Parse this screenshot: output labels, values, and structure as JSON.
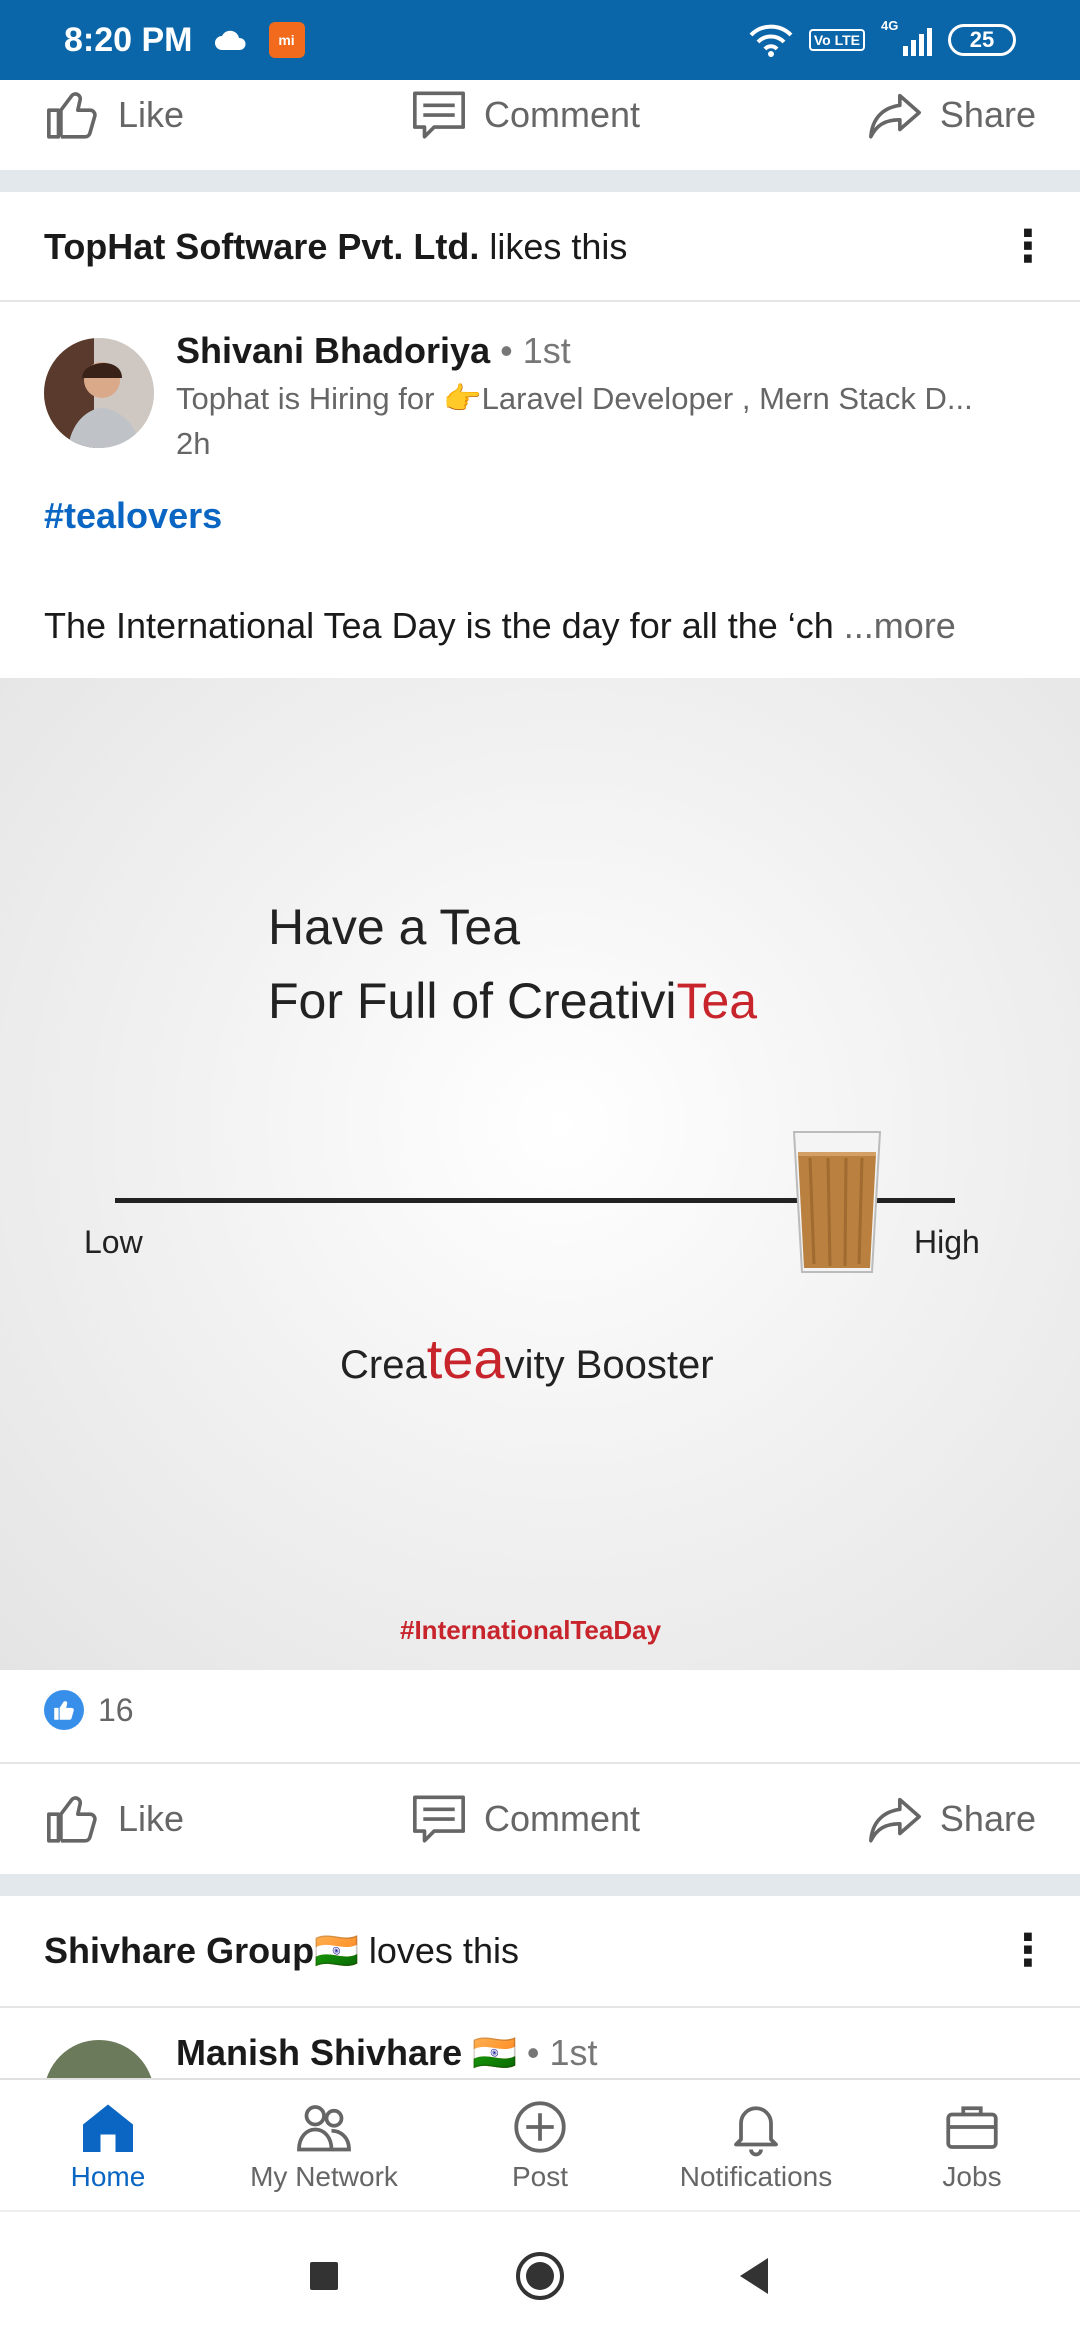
{
  "status_bar": {
    "time": "8:20 PM",
    "battery": "25",
    "network": "4G",
    "volte": "Vo LTE",
    "mi_badge": "mi"
  },
  "top_actions": {
    "like": "Like",
    "comment": "Comment",
    "share": "Share"
  },
  "post": {
    "context_company": "TopHat Software Pvt. Ltd.",
    "context_suffix": " likes this",
    "author_name": "Shivani Bhadoriya",
    "author_degree": " • 1st",
    "author_headline": "Tophat is Hiring for 👉Laravel Developer , Mern Stack D...",
    "time": "2h",
    "hashtag": "#tealovers",
    "text": "The International Tea Day is the day for all the ‘ch ",
    "more_label": "...more",
    "image": {
      "line1": "Have a Tea",
      "line2_prefix": "For Full of Creativi",
      "line2_highlight": "Tea",
      "low_label": "Low",
      "high_label": "High",
      "booster_prefix": "Crea",
      "booster_highlight": "tea",
      "booster_suffix": "vity Booster",
      "hashtag": "#InternationalTeaDay"
    },
    "reactions_count": "16",
    "actions": {
      "like": "Like",
      "comment": "Comment",
      "share": "Share"
    }
  },
  "next_post": {
    "context_company": "Shivhare Group🇮🇳",
    "context_suffix": " loves this",
    "author_name": "Manish Shivhare 🇮🇳",
    "author_degree": " • 1st"
  },
  "bottom_nav": [
    {
      "label": "Home",
      "icon": "home-icon",
      "active": true
    },
    {
      "label": "My Network",
      "icon": "network-icon"
    },
    {
      "label": "Post",
      "icon": "post-icon"
    },
    {
      "label": "Notifications",
      "icon": "bell-icon"
    },
    {
      "label": "Jobs",
      "icon": "briefcase-icon"
    }
  ],
  "colors": {
    "brand": "#0a66c2",
    "status_bar": "#0a66a8",
    "tea_red": "#c8242b"
  }
}
